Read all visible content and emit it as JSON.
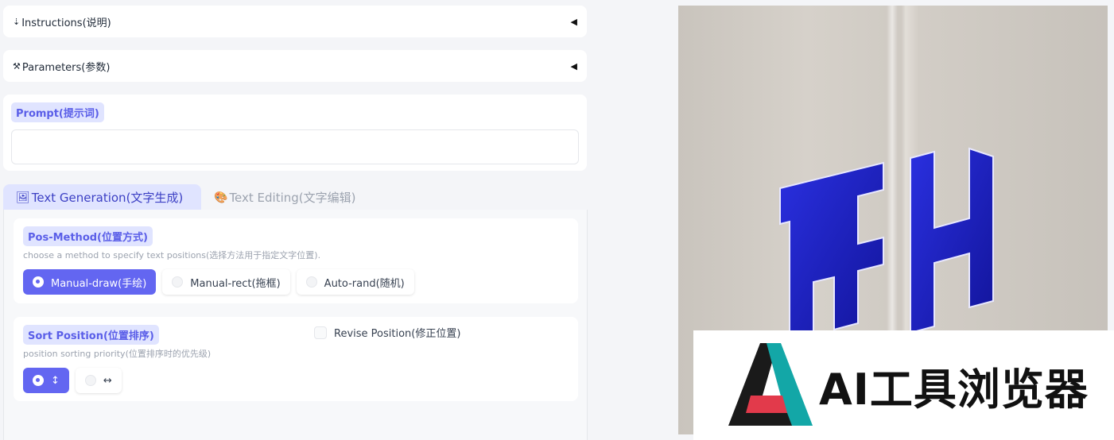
{
  "accordions": [
    {
      "icon": "⇣",
      "label": "Instructions(说明)",
      "arrow": "◀"
    },
    {
      "icon": "⚒",
      "label": "Parameters(参数)",
      "arrow": "◀"
    }
  ],
  "prompt": {
    "label": "Prompt(提示词)",
    "value": "",
    "placeholder": ""
  },
  "tabs": [
    {
      "icon": "🖼",
      "label": "Text Generation(文字生成)",
      "active": true
    },
    {
      "icon": "🎨",
      "label": "Text Editing(文字编辑)",
      "active": false
    }
  ],
  "pos_method": {
    "label": "Pos-Method(位置方式)",
    "info": "choose a method to specify text positions(选择方法用于指定文字位置).",
    "options": [
      "Manual-draw(手绘)",
      "Manual-rect(拖框)",
      "Auto-rand(随机)"
    ],
    "selected": "Manual-draw(手绘)"
  },
  "sort_position": {
    "label": "Sort Position(位置排序)",
    "info": "position sorting priority(位置排序时的优先级)",
    "options": [
      "↕",
      "↔"
    ],
    "selected": "↕"
  },
  "revise_position": {
    "label": "Revise Position(修正位置)",
    "checked": false
  },
  "preview": {
    "sign_text": "FH",
    "watermark_text": "AI工具浏览器",
    "colors": {
      "sign_blue": "#1c1fc2",
      "logo_teal": "#13a7a7",
      "logo_red": "#e23a4b",
      "logo_black": "#1a1a1a"
    }
  },
  "colors": {
    "accent": "#6366f1",
    "label_bg": "#e0e4ff",
    "label_text": "#5a5ee8"
  }
}
